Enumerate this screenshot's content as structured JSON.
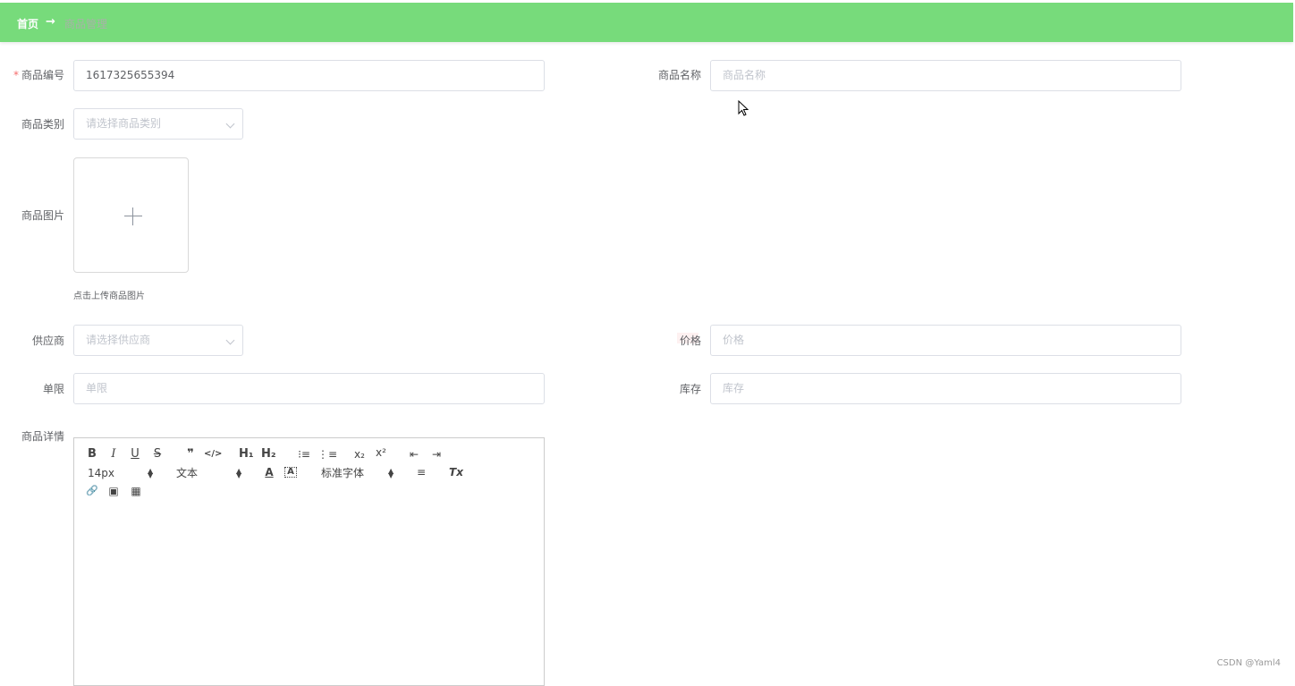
{
  "breadcrumb": {
    "home": "首页",
    "separator": "→",
    "current": "商品管理"
  },
  "form": {
    "code": {
      "label": "商品编号",
      "required_mark": "*",
      "value": "1617325655394"
    },
    "name": {
      "label": "商品名称",
      "placeholder": "商品名称"
    },
    "category": {
      "label": "商品类别",
      "placeholder": "请选择商品类别"
    },
    "image": {
      "label": "商品图片",
      "tip": "点击上传商品图片"
    },
    "supplier": {
      "label": "供应商",
      "placeholder": "请选择供应商"
    },
    "price": {
      "label": "价格",
      "placeholder": "价格"
    },
    "limit": {
      "label": "单限",
      "placeholder": "单限"
    },
    "stock": {
      "label": "库存",
      "placeholder": "库存"
    },
    "detail": {
      "label": "商品详情"
    }
  },
  "editor": {
    "bold": "B",
    "italic": "I",
    "underline": "U",
    "strike": "S",
    "quote": "❞",
    "code": "</>",
    "h1": "H₁",
    "h2": "H₂",
    "ordered_list": "⁝≡",
    "bullet_list": "⋮≡",
    "sub": "x₂",
    "sup": "x²",
    "outdent": "⇤",
    "indent": "⇥",
    "size": "14px",
    "header": "文本",
    "font": "标准字体",
    "color": "A",
    "background": "A",
    "align": "≡",
    "clean": "Tx",
    "link": "🔗",
    "image": "▣",
    "video": "▦"
  },
  "watermark": "CSDN @Yaml4"
}
